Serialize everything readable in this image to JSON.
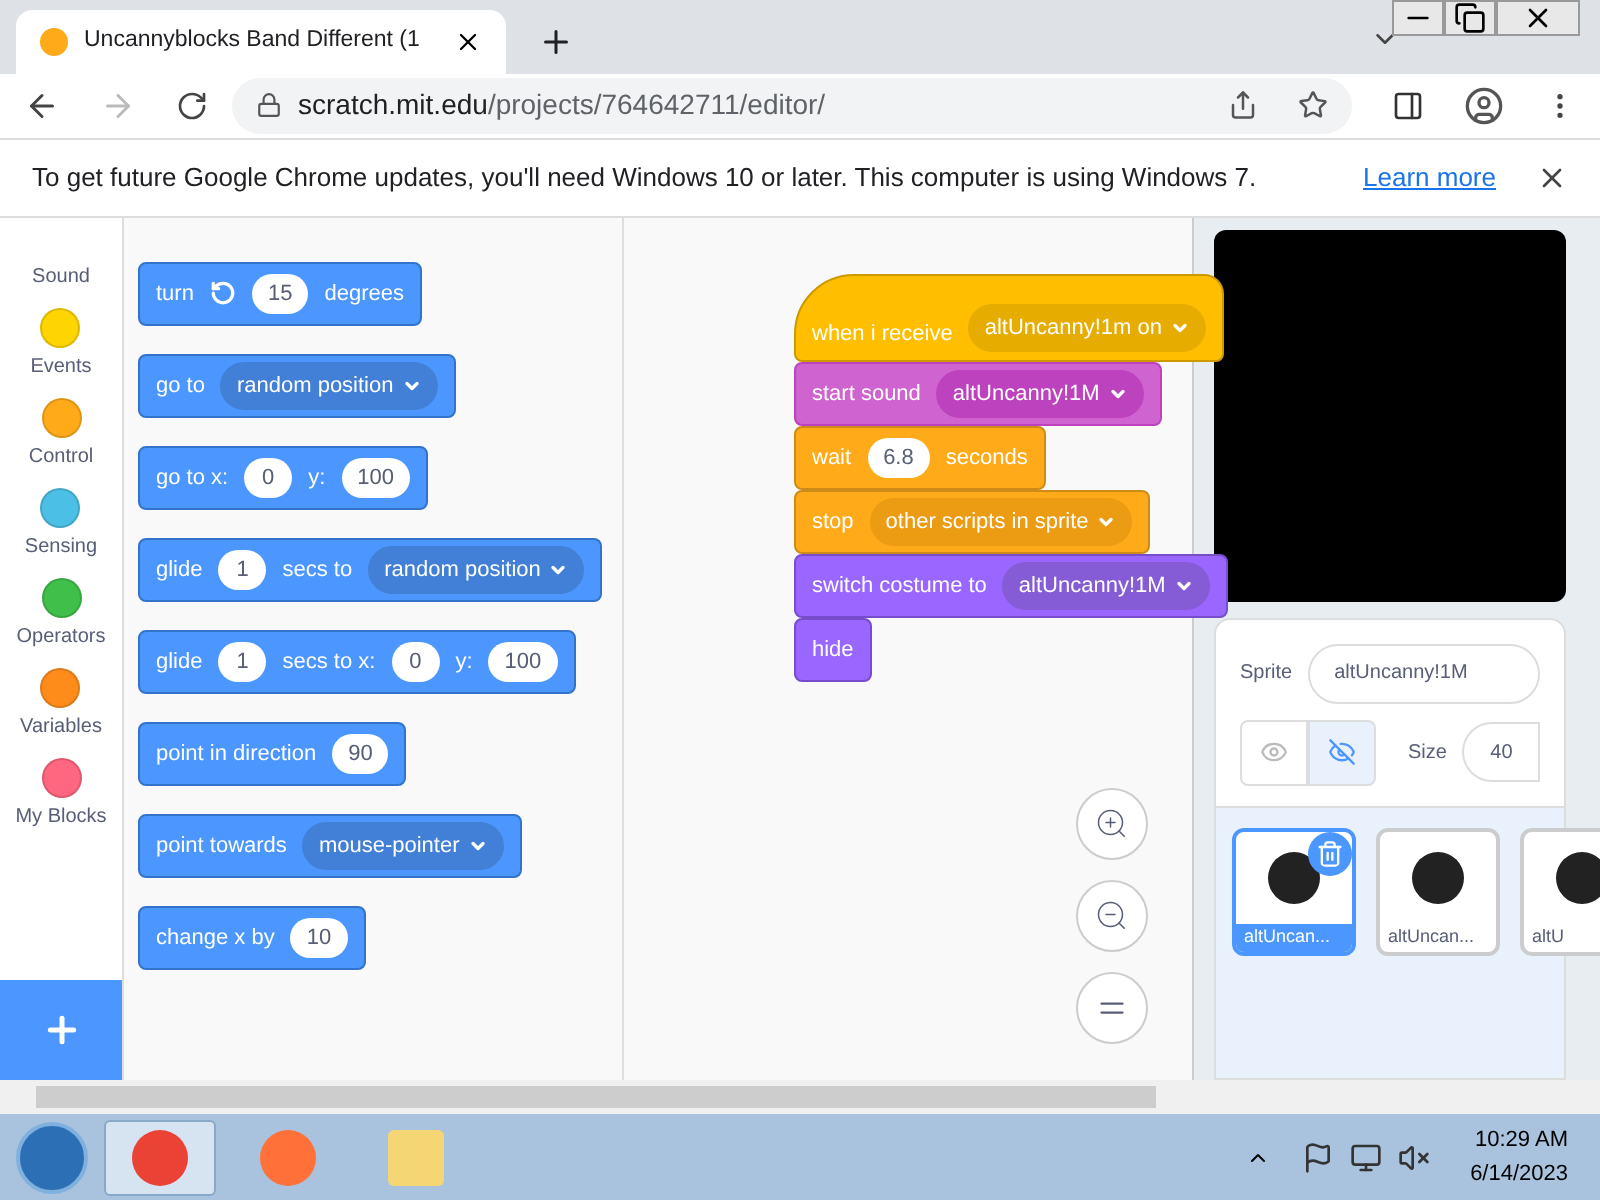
{
  "browser": {
    "tab": {
      "title": "Uncannyblocks Band Different (1"
    },
    "url": {
      "host": "scratch.mit.edu",
      "path": "/projects/764642711/editor/"
    }
  },
  "infobar": {
    "message": "To get future Google Chrome updates, you'll need Windows 10 or later. This computer is using Windows 7.",
    "link": "Learn more"
  },
  "categories": [
    {
      "label": "Sound"
    },
    {
      "label": "Events",
      "color": "#ffd500"
    },
    {
      "label": "Control",
      "color": "#ffab19"
    },
    {
      "label": "Sensing",
      "color": "#4cbfe6"
    },
    {
      "label": "Operators",
      "color": "#40bf4a"
    },
    {
      "label": "Variables",
      "color": "#ff8c1a"
    },
    {
      "label": "My Blocks",
      "color": "#ff6680"
    }
  ],
  "palette": [
    {
      "kind": "motion",
      "parts": [
        {
          "kind": "text",
          "text": "turn"
        },
        {
          "kind": "icon"
        },
        {
          "kind": "number",
          "text": "15"
        },
        {
          "kind": "text",
          "text": "degrees"
        }
      ]
    },
    {
      "kind": "motion",
      "parts": [
        {
          "kind": "text",
          "text": "go to"
        },
        {
          "kind": "dropdown",
          "text": "random position"
        }
      ]
    },
    {
      "kind": "motion",
      "parts": [
        {
          "kind": "text",
          "text": "go to x:"
        },
        {
          "kind": "number",
          "text": "0"
        },
        {
          "kind": "text",
          "text": "y:"
        },
        {
          "kind": "number",
          "text": "100"
        }
      ]
    },
    {
      "kind": "motion",
      "parts": [
        {
          "kind": "text",
          "text": "glide"
        },
        {
          "kind": "number",
          "text": "1"
        },
        {
          "kind": "text",
          "text": "secs to"
        },
        {
          "kind": "dropdown",
          "text": "random position"
        }
      ]
    },
    {
      "kind": "motion",
      "parts": [
        {
          "kind": "text",
          "text": "glide"
        },
        {
          "kind": "number",
          "text": "1"
        },
        {
          "kind": "text",
          "text": "secs to x:"
        },
        {
          "kind": "number",
          "text": "0"
        },
        {
          "kind": "text",
          "text": "y:"
        },
        {
          "kind": "number",
          "text": "100"
        }
      ]
    },
    {
      "kind": "motion",
      "parts": [
        {
          "kind": "text",
          "text": "point in direction"
        },
        {
          "kind": "number",
          "text": "90"
        }
      ]
    },
    {
      "kind": "motion",
      "parts": [
        {
          "kind": "text",
          "text": "point towards"
        },
        {
          "kind": "dropdown",
          "text": "mouse-pointer"
        }
      ]
    },
    {
      "kind": "motion",
      "parts": [
        {
          "kind": "text",
          "text": "change x by"
        },
        {
          "kind": "number",
          "text": "10"
        }
      ]
    }
  ],
  "script": [
    {
      "kind": "events",
      "hat": true,
      "parts": [
        {
          "kind": "text",
          "text": "when i receive"
        },
        {
          "kind": "dropdown",
          "text": "altUncanny!1m on"
        }
      ]
    },
    {
      "kind": "sound",
      "hat": false,
      "parts": [
        {
          "kind": "text",
          "text": "start sound"
        },
        {
          "kind": "dropdown",
          "text": "altUncanny!1M"
        }
      ]
    },
    {
      "kind": "control",
      "hat": false,
      "parts": [
        {
          "kind": "text",
          "text": "wait"
        },
        {
          "kind": "number",
          "text": "6.8"
        },
        {
          "kind": "text",
          "text": "seconds"
        }
      ]
    },
    {
      "kind": "control",
      "hat": false,
      "parts": [
        {
          "kind": "text",
          "text": "stop"
        },
        {
          "kind": "dropdown",
          "text": "other scripts in sprite"
        }
      ]
    },
    {
      "kind": "looks",
      "hat": false,
      "parts": [
        {
          "kind": "text",
          "text": "switch costume to"
        },
        {
          "kind": "dropdown",
          "text": "altUncanny!1M"
        }
      ]
    },
    {
      "kind": "looks",
      "hat": false,
      "parts": [
        {
          "kind": "text",
          "text": "hide"
        }
      ]
    }
  ],
  "sprite_info": {
    "sprite_label": "Sprite",
    "sprite_name": "altUncanny!1M",
    "show_visible": false,
    "size_label": "Size",
    "size": "40"
  },
  "sprites": [
    {
      "name": "altUncan...",
      "selected": true
    },
    {
      "name": "altUncan...",
      "selected": false
    },
    {
      "name": "altU",
      "selected": false
    }
  ],
  "taskbar": {
    "apps": [
      {
        "kind": "chrome",
        "selected": true
      },
      {
        "kind": "firefox",
        "selected": false
      },
      {
        "kind": "explorer",
        "selected": false
      }
    ],
    "time": "10:29 AM",
    "date": "6/14/2023"
  }
}
